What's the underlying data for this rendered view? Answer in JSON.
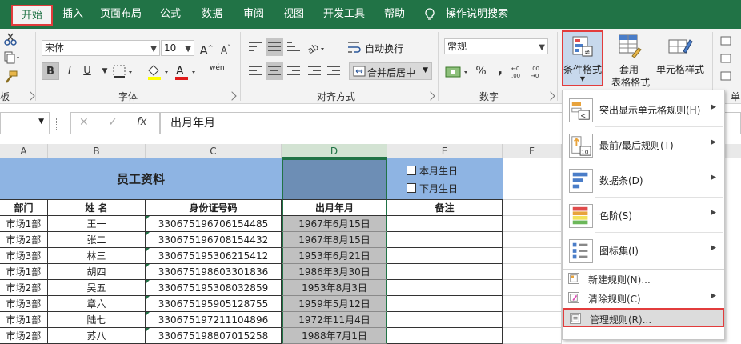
{
  "tabs": [
    "开始",
    "插入",
    "页面布局",
    "公式",
    "数据",
    "审阅",
    "视图",
    "开发工具",
    "帮助",
    "操作说明搜索"
  ],
  "ribbon": {
    "font_name": "宋体",
    "font_size": "10",
    "bold": "B",
    "italic": "I",
    "underline": "U",
    "phonetic": "wén",
    "wrap_text": "自动换行",
    "merge_center": "合并后居中",
    "number_format": "常规",
    "percent": "%",
    "comma": ",",
    "group_font": "字体",
    "group_align": "对齐方式",
    "group_number": "数字",
    "cond_format": "条件格式",
    "table_format_1": "套用",
    "table_format_2": "表格格式",
    "cell_style": "单元格样式",
    "group_partial": "单",
    "group_clipboard_partial": "板"
  },
  "formula_bar": {
    "content": "出月年月",
    "fx": "fx"
  },
  "columns": [
    "A",
    "B",
    "C",
    "D",
    "E",
    "F"
  ],
  "sheet": {
    "title": "员工资料",
    "checkbox_1": "本月生日",
    "checkbox_2": "下月生日",
    "headers": [
      "部门",
      "姓  名",
      "身份证号码",
      "出月年月",
      "备注"
    ],
    "rows": [
      [
        "市场1部",
        "王一",
        "330675196706154485",
        "1967年6月15日",
        ""
      ],
      [
        "市场2部",
        "张二",
        "330675196708154432",
        "1967年8月15日",
        ""
      ],
      [
        "市场3部",
        "林三",
        "330675195306215412",
        "1953年6月21日",
        ""
      ],
      [
        "市场1部",
        "胡四",
        "330675198603301836",
        "1986年3月30日",
        ""
      ],
      [
        "市场2部",
        "吴五",
        "330675195308032859",
        "1953年8月3日",
        ""
      ],
      [
        "市场3部",
        "章六",
        "330675195905128755",
        "1959年5月12日",
        ""
      ],
      [
        "市场1部",
        "陆七",
        "330675197211104896",
        "1972年11月4日",
        ""
      ],
      [
        "市场2部",
        "苏八",
        "330675198807015258",
        "1988年7月1日",
        ""
      ]
    ]
  },
  "menu": {
    "items": [
      {
        "label": "突出显示单元格规则(H)"
      },
      {
        "label": "最前/最后规则(T)"
      },
      {
        "label": "数据条(D)"
      },
      {
        "label": "色阶(S)"
      },
      {
        "label": "图标集(I)"
      }
    ],
    "new_rule": "新建规则(N)...",
    "clear_rule": "清除规则(C)",
    "manage_rule": "管理规则(R)..."
  },
  "colors": {
    "accent": "#217346",
    "highlight": "#e23c3c",
    "title_bg": "#8eb4e3",
    "sel_bg": "#6d8eb5",
    "date_bg": "#c0c0c0"
  }
}
